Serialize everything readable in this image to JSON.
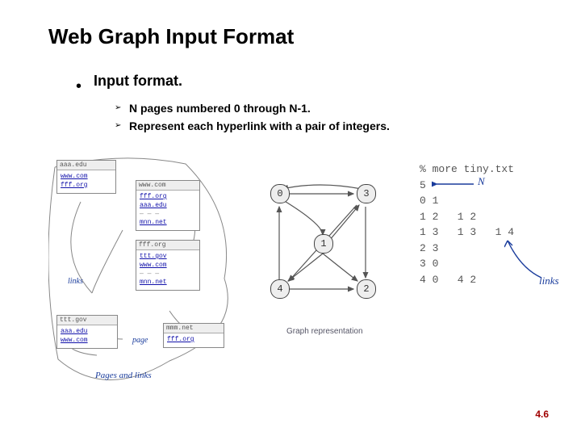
{
  "title": "Web Graph Input Format",
  "sub": "Input format.",
  "bullets": {
    "b1": "N pages numbered 0 through N-1.",
    "b2": "Represent each hyperlink with a pair of integers."
  },
  "fig1": {
    "caption": "Pages and links",
    "links_label": "links",
    "page_label": "page",
    "browsers": {
      "aaa": {
        "url": "aaa.edu",
        "lines": [
          "www.com",
          "fff.org"
        ]
      },
      "www": {
        "url": "www.com",
        "lines": [
          "fff.org",
          "aaa.edu",
          "mnn.net"
        ]
      },
      "fff": {
        "url": "fff.org",
        "lines": [
          "ttt.gov",
          "www.com",
          "mnn.net"
        ]
      },
      "ttt": {
        "url": "ttt.gov",
        "lines": [
          "aaa.edu",
          "www.com"
        ]
      },
      "mmm": {
        "url": "mmm.net",
        "lines": [
          "fff.org"
        ]
      }
    }
  },
  "fig2": {
    "caption": "Graph representation",
    "nodes": [
      "0",
      "1",
      "2",
      "3",
      "4"
    ]
  },
  "fig3": {
    "cmd": "% more tiny.txt",
    "lines": [
      "5",
      "0 1",
      "1 2   1 2",
      "1 3   1 3   1 4",
      "2 3",
      "3 0",
      "4 0   4 2"
    ],
    "ann_N": "N",
    "ann_links": "links"
  },
  "page_num": "4.6"
}
